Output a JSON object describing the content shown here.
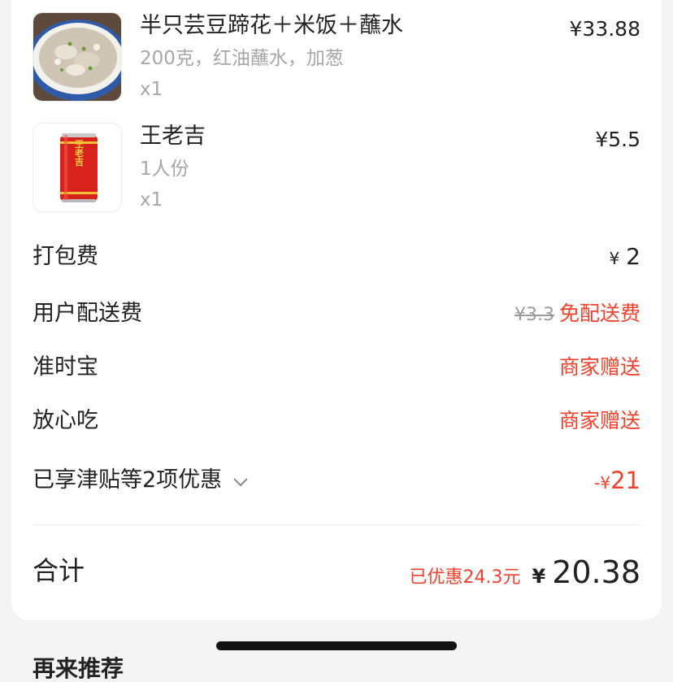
{
  "items": [
    {
      "name": "半只芸豆蹄花＋米饭＋蘸水",
      "spec": "200克，红油蘸水，加葱",
      "qty": "x1",
      "price": "¥33.88",
      "image_icon": "soup-bowl-photo"
    },
    {
      "name": "王老吉",
      "spec": "1人份",
      "qty": "x1",
      "price": "¥5.5",
      "image_icon": "wanglaoji-can-photo",
      "can_text": "王老吉"
    }
  ],
  "fees": {
    "packing": {
      "label": "打包费",
      "currency": "¥",
      "amount": "2"
    },
    "delivery": {
      "label": "用户配送费",
      "original": "¥3.3",
      "value": "免配送费"
    },
    "ontime": {
      "label": "准时宝",
      "value": "商家赠送"
    },
    "safe_eat": {
      "label": "放心吃",
      "value": "商家赠送"
    }
  },
  "discount": {
    "label": "已享津贴等2项优惠",
    "prefix": "-¥",
    "amount": "21",
    "icon": "chevron-down-icon"
  },
  "total": {
    "label": "合计",
    "saved": "已优惠24.3元",
    "currency": "¥",
    "amount": "20.38"
  },
  "next_section": {
    "title": "再来推荐"
  },
  "colors": {
    "accent": "#f2412b",
    "text": "#222222",
    "muted": "#a6a6a6",
    "card_bg": "#ffffff",
    "page_bg": "#f4f4f4"
  }
}
